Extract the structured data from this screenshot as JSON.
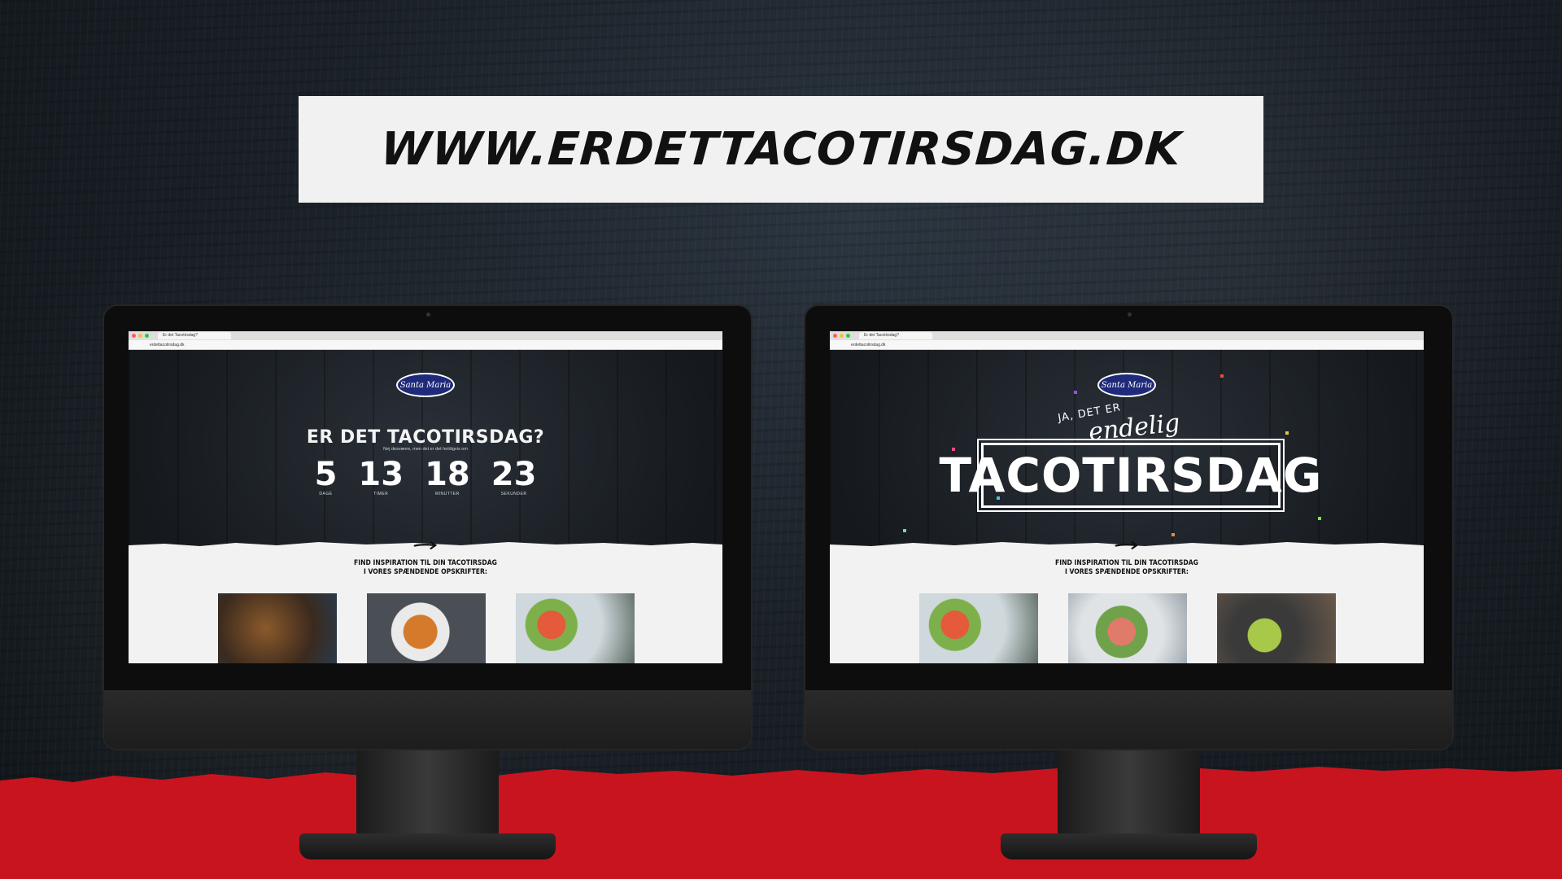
{
  "banner": {
    "url_text": "WWW.ERDETTACOTIRSDAG.DK"
  },
  "colors": {
    "accent_red": "#c8141f",
    "logo_blue": "#1f2a7a",
    "banner_bg": "#f1f1f1"
  },
  "left_screen": {
    "tab_title": "Er det Tacotirsdag?",
    "address": "erdettacotirsdag.dk",
    "logo": "Santa Maria",
    "headline": "ER DET TACOTIRSDAG?",
    "subline": "Nej desværre, men det er det heldigvis om",
    "countdown": [
      {
        "value": "5",
        "label": "DAGE"
      },
      {
        "value": "13",
        "label": "TIMER"
      },
      {
        "value": "18",
        "label": "MINUTTER"
      },
      {
        "value": "23",
        "label": "SEKUNDER"
      }
    ],
    "inspiration": "FIND INSPIRATION TIL DIN TACOTIRSDAG\nI VORES SPÆNDENDE OPSKRIFTER:"
  },
  "right_screen": {
    "tab_title": "Er det Tacotirsdag?",
    "address": "erdettacotirsdag.dk",
    "logo": "Santa Maria",
    "pre": "JA, DET ER",
    "script": "endelig",
    "headline": "TACOTIRSDAG",
    "inspiration": "FIND INSPIRATION TIL DIN TACOTIRSDAG\nI VORES SPÆNDENDE OPSKRIFTER:"
  }
}
